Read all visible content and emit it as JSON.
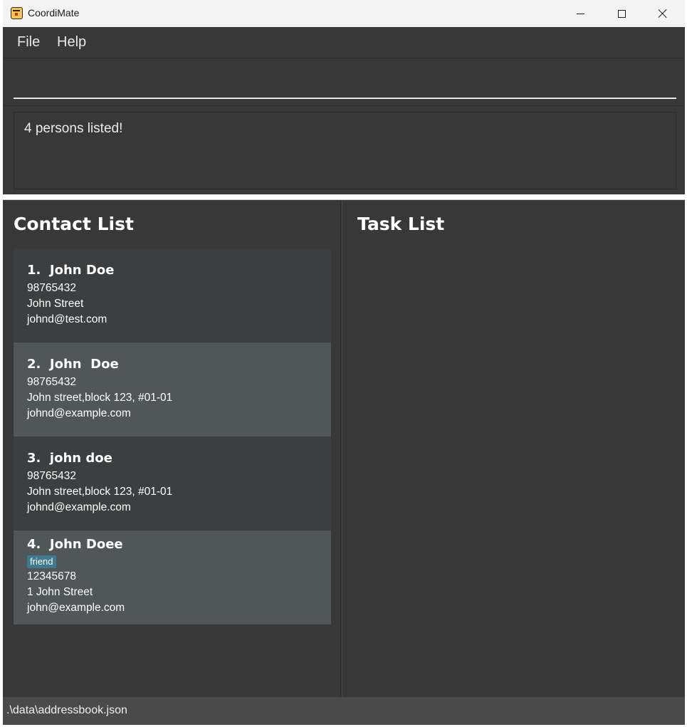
{
  "window": {
    "title": "CoordiMate",
    "minimize_icon": "minimize-icon",
    "maximize_icon": "maximize-icon",
    "close_icon": "close-icon"
  },
  "menu": {
    "file": "File",
    "help": "Help"
  },
  "command": {
    "value": "",
    "placeholder": ""
  },
  "result": {
    "text": "4 persons listed!"
  },
  "contacts": {
    "title": "Contact List",
    "items": [
      {
        "index": "1.",
        "name": "John Doe",
        "tags": [],
        "phone": "98765432",
        "address": "John Street",
        "email": "johnd@test.com"
      },
      {
        "index": "2.",
        "name": "John  Doe",
        "tags": [],
        "phone": "98765432",
        "address": "John street,block 123, #01-01",
        "email": "johnd@example.com"
      },
      {
        "index": "3.",
        "name": "john doe",
        "tags": [],
        "phone": "98765432",
        "address": "John street,block 123, #01-01",
        "email": "johnd@example.com"
      },
      {
        "index": "4.",
        "name": "John Doee",
        "tags": [
          "friend"
        ],
        "phone": "12345678",
        "address": "1 John Street",
        "email": "john@example.com"
      }
    ]
  },
  "tasks": {
    "title": "Task List",
    "items": []
  },
  "status": {
    "path": ".\\data\\addressbook.json"
  },
  "colors": {
    "background": "#383838",
    "card_alt": "#515658",
    "tag": "#3e7b91",
    "statusbar": "#4a4a4a"
  }
}
